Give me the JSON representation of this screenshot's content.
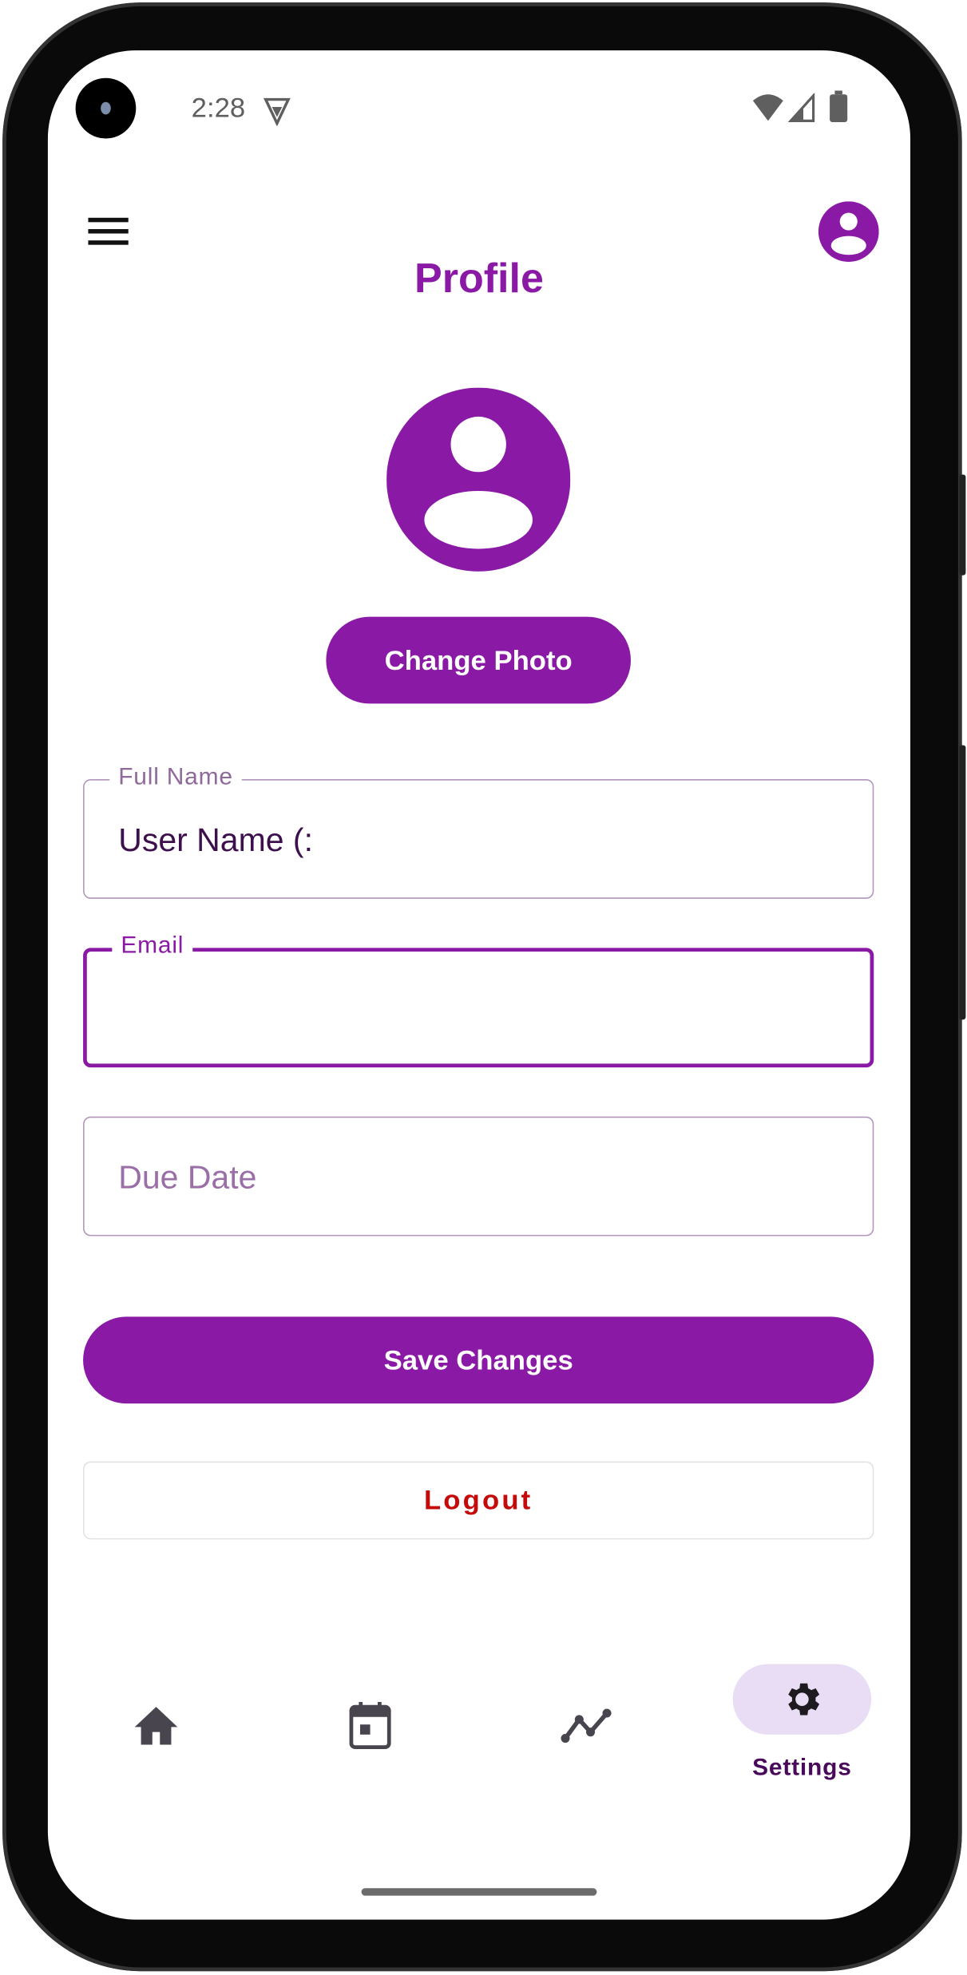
{
  "status_bar": {
    "time": "2:28"
  },
  "header": {
    "title": "Profile"
  },
  "profile": {
    "change_photo_label": "Change Photo"
  },
  "form": {
    "full_name": {
      "label": "Full Name",
      "value": "User Name (:"
    },
    "email": {
      "label": "Email",
      "value": ""
    },
    "due_date": {
      "placeholder": "Due Date",
      "value": ""
    }
  },
  "actions": {
    "save_label": "Save Changes",
    "logout_label": "Logout"
  },
  "bottom_nav": {
    "items": [
      {
        "icon": "home-icon"
      },
      {
        "icon": "calendar-icon"
      },
      {
        "icon": "trend-icon"
      },
      {
        "icon": "settings-icon",
        "label": "Settings",
        "active": true
      }
    ]
  },
  "colors": {
    "accent": "#8a1aa6",
    "danger": "#c50a0a",
    "nav_active_bg": "#e8ddf5"
  }
}
